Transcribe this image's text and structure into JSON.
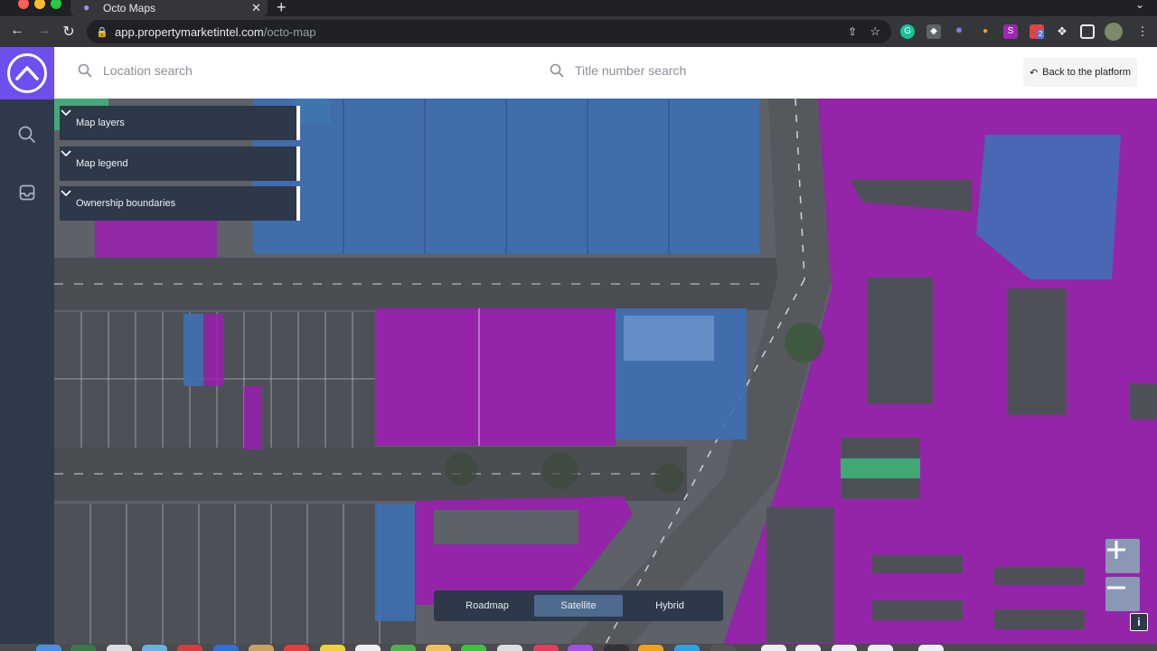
{
  "browser": {
    "tab_title": "Octo Maps",
    "url_host": "app.propertymarketintel.com",
    "url_path": "/octo-map",
    "extension_badge": "2"
  },
  "header": {
    "location_search_placeholder": "Location search",
    "title_search_placeholder": "Title number search",
    "back_label": "Back to the platform"
  },
  "panels": [
    {
      "label": "Map layers"
    },
    {
      "label": "Map legend"
    },
    {
      "label": "Ownership boundaries"
    }
  ],
  "map_types": [
    {
      "label": "Roadmap",
      "active": false
    },
    {
      "label": "Satellite",
      "active": true
    },
    {
      "label": "Hybrid",
      "active": false
    }
  ],
  "info_label": "i",
  "colors": {
    "accent": "#6f4ef0",
    "sidebar": "#2e3a4a",
    "parcel_purple": "#9a1fb0",
    "parcel_blue": "#3f6fb5",
    "parcel_green": "#33c27a"
  }
}
